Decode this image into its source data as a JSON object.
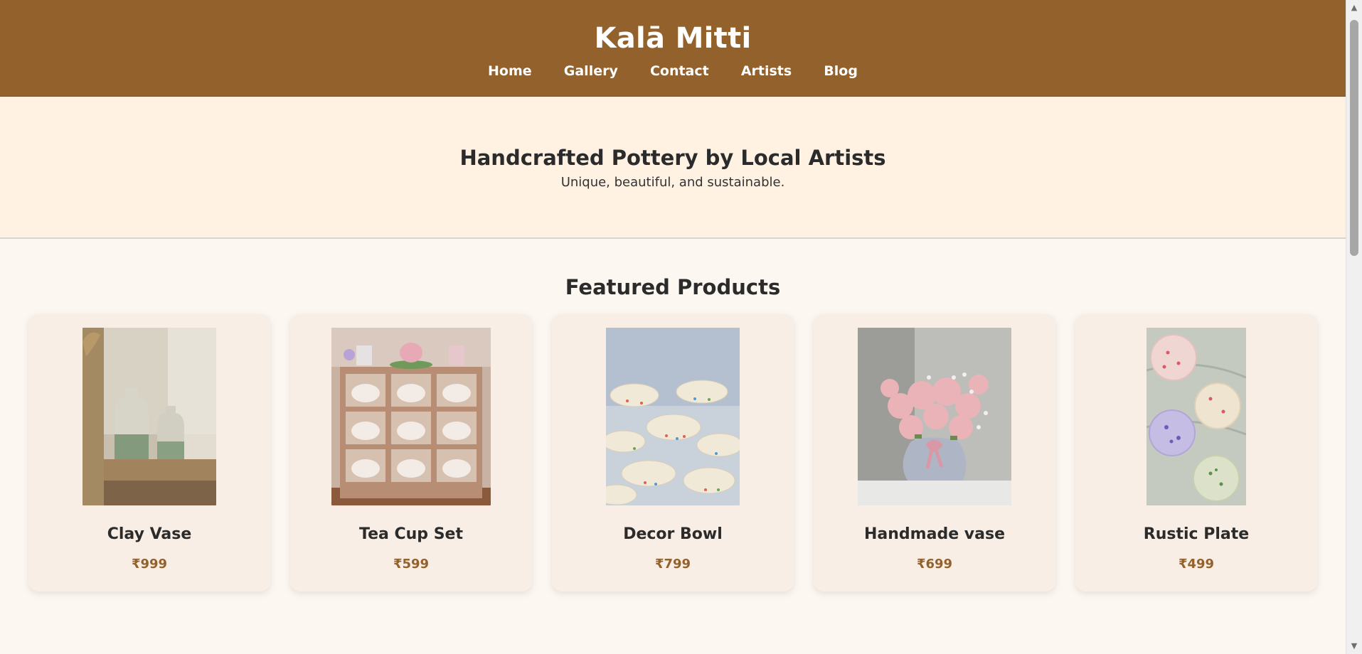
{
  "header": {
    "brand": "Kalā Mitti",
    "nav": [
      "Home",
      "Gallery",
      "Contact",
      "Artists",
      "Blog"
    ]
  },
  "hero": {
    "title": "Handcrafted Pottery by Local Artists",
    "subtitle": "Unique, beautiful, and sustainable."
  },
  "products": {
    "heading": "Featured Products",
    "items": [
      {
        "name": "Clay Vase",
        "price": "₹999",
        "image": "clay-vase-photo"
      },
      {
        "name": "Tea Cup Set",
        "price": "₹599",
        "image": "tea-cup-set-photo"
      },
      {
        "name": "Decor Bowl",
        "price": "₹799",
        "image": "decor-bowl-photo"
      },
      {
        "name": "Handmade vase",
        "price": "₹699",
        "image": "handmade-vase-photo"
      },
      {
        "name": "Rustic Plate",
        "price": "₹499",
        "image": "rustic-plate-photo"
      }
    ]
  },
  "colors": {
    "header_bg": "#93612b",
    "hero_bg": "#fff2e3",
    "page_bg": "#fdf7f2",
    "card_bg": "#f8eee5",
    "price": "#93612b"
  },
  "scrollbar": {
    "up_icon": "▲",
    "down_icon": "▼"
  }
}
